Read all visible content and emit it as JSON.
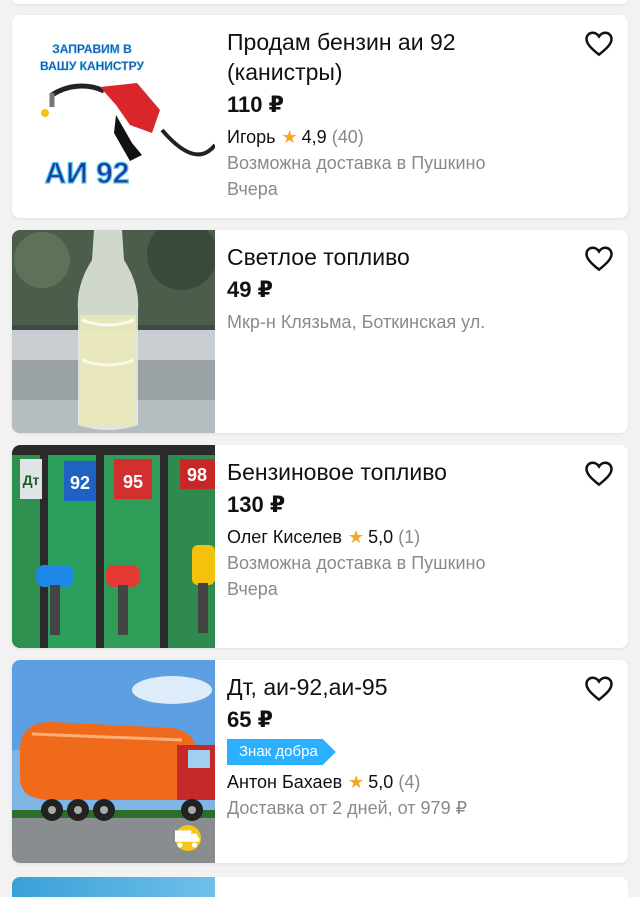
{
  "listings": [
    {
      "title": "Продам бензин аи 92 (канистры)",
      "price": "110 ₽",
      "seller": "Игорь",
      "rating": "4,9",
      "reviews": "(40)",
      "delivery": "Возможна доставка в Пушкино",
      "date": "Вчера",
      "image_text_top": "ЗАПРАВИМ В\nВАШУ КАНИСТРУ",
      "image_text_big": "АИ 92"
    },
    {
      "title": "Светлое топливо",
      "price": "49 ₽",
      "location": "Мкр-н Клязьма, Боткинская ул."
    },
    {
      "title": "Бензиновое топливо",
      "price": "130 ₽",
      "seller": "Олег Киселев",
      "rating": "5,0",
      "reviews": "(1)",
      "delivery": "Возможна доставка в Пушкино",
      "date": "Вчера",
      "pump_labels": [
        "Дт",
        "92",
        "95",
        "98"
      ]
    },
    {
      "title": "Дт, аи-92,аи-95",
      "price": "65 ₽",
      "badge": "Знак добра",
      "seller": "Антон Бахаев",
      "rating": "5,0",
      "reviews": "(4)",
      "delivery": "Доставка от 2 дней, от 979 ₽"
    }
  ],
  "colors": {
    "star": "#f5a623",
    "badge": "#2bb0ff",
    "muted": "#8a8a8a"
  },
  "icons": {
    "favorite": "heart-outline-icon",
    "rating": "star-icon",
    "delivery": "truck-icon"
  }
}
